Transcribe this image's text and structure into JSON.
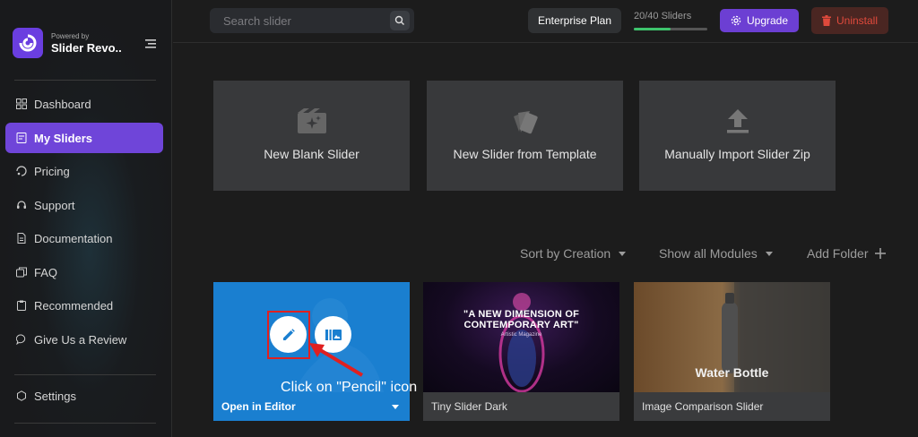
{
  "brand": {
    "powered_by": "Powered by",
    "name": "Slider Revo.."
  },
  "sidebar": {
    "items": [
      {
        "label": "Dashboard",
        "icon": "grid-icon"
      },
      {
        "label": "My Sliders",
        "icon": "sliders-icon",
        "active": true
      },
      {
        "label": "Pricing",
        "icon": "tag-icon"
      },
      {
        "label": "Support",
        "icon": "headset-icon"
      },
      {
        "label": "Documentation",
        "icon": "document-icon"
      },
      {
        "label": "FAQ",
        "icon": "faq-icon"
      },
      {
        "label": "Recommended",
        "icon": "clipboard-icon"
      },
      {
        "label": "Give Us a Review",
        "icon": "chat-icon"
      }
    ],
    "settings": {
      "label": "Settings",
      "icon": "gear-icon"
    }
  },
  "topbar": {
    "search_placeholder": "Search slider",
    "plan": "Enterprise Plan",
    "slider_count": "20/40 Sliders",
    "slider_usage": 0.5,
    "upgrade": "Upgrade",
    "uninstall": "Uninstall"
  },
  "create": [
    {
      "label": "New Blank Slider",
      "icon": "film-sparkle-icon"
    },
    {
      "label": "New Slider from Template",
      "icon": "swatches-icon"
    },
    {
      "label": "Manually Import Slider Zip",
      "icon": "upload-icon"
    }
  ],
  "filters": {
    "sort": "Sort by Creation",
    "modules": "Show all Modules",
    "add_folder": "Add Folder"
  },
  "sliders": [
    {
      "footer": "Open in Editor"
    },
    {
      "footer": "Tiny Slider Dark",
      "headline_1": "\"A NEW DIMENSION OF",
      "headline_2": "CONTEMPORARY ART\"",
      "sub": "Artistic Magazine"
    },
    {
      "footer": "Image Comparison Slider",
      "overlay": "Water Bottle"
    }
  ],
  "annotation": {
    "callout": "Click on \"Pencil\" icon"
  },
  "colors": {
    "accent": "#6f45d9",
    "editor_blue": "#1a7fd0",
    "danger": "#e04a3c",
    "highlight": "#e02020"
  }
}
